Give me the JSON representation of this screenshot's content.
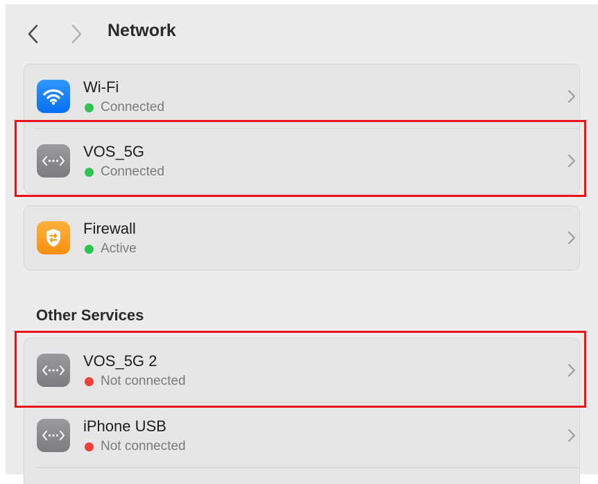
{
  "toolbar": {
    "title": "Network",
    "back_icon": "chevron-left-icon",
    "forward_icon": "chevron-right-icon"
  },
  "services": [
    {
      "name": "Wi-Fi",
      "status": "Connected",
      "status_color": "#2fc351",
      "icon": "wifi-icon"
    },
    {
      "name": "VOS_5G",
      "status": "Connected",
      "status_color": "#2fc351",
      "icon": "vpn-icon"
    }
  ],
  "firewall": {
    "name": "Firewall",
    "status": "Active",
    "status_color": "#2fc351",
    "icon": "firewall-icon"
  },
  "other_services": {
    "heading": "Other Services",
    "items": [
      {
        "name": "VOS_5G 2",
        "status": "Not connected",
        "status_color": "#f0403a",
        "icon": "vpn-icon"
      },
      {
        "name": "iPhone USB",
        "status": "Not connected",
        "status_color": "#f0403a",
        "icon": "vpn-icon"
      }
    ]
  },
  "colors": {
    "highlight": "#e8141a",
    "connected": "#2fc351",
    "disconnected": "#f0403a",
    "wifi_blue": "#1a84f8",
    "firewall_orange": "#f9a126"
  }
}
